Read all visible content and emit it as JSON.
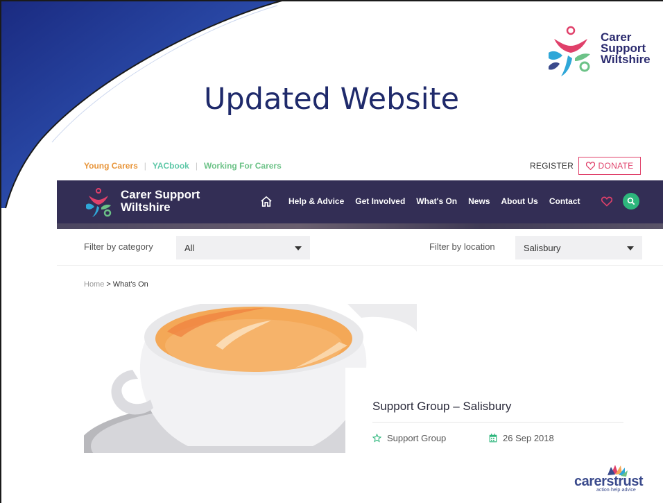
{
  "slide": {
    "title": "Updated Website",
    "brand": {
      "line1": "Carer",
      "line2": "Support",
      "line3": "Wiltshire"
    }
  },
  "topbar": {
    "links": [
      "Young Carers",
      "YACbook",
      "Working For Carers"
    ],
    "register": "REGISTER",
    "donate": "DONATE"
  },
  "navbar": {
    "brand_line1": "Carer Support",
    "brand_line2": "Wiltshire",
    "items": [
      "Help & Advice",
      "Get Involved",
      "What's On",
      "News",
      "About Us",
      "Contact"
    ]
  },
  "filters": {
    "category_label": "Filter by category",
    "category_value": "All",
    "location_label": "Filter by location",
    "location_value": "Salisbury"
  },
  "breadcrumb": {
    "home": "Home",
    "arrow": ">",
    "current": "What's On"
  },
  "event": {
    "title": "Support Group – Salisbury",
    "category": "Support Group",
    "date": "26 Sep 2018"
  },
  "footer": {
    "logo_word_a": "carers",
    "logo_word_b": "trust",
    "tagline": "action·help·advice"
  },
  "colors": {
    "nav_bg": "#332e55",
    "accent_pink": "#e0406a",
    "search_green": "#2db67c",
    "title_blue": "#1f2a6b"
  }
}
